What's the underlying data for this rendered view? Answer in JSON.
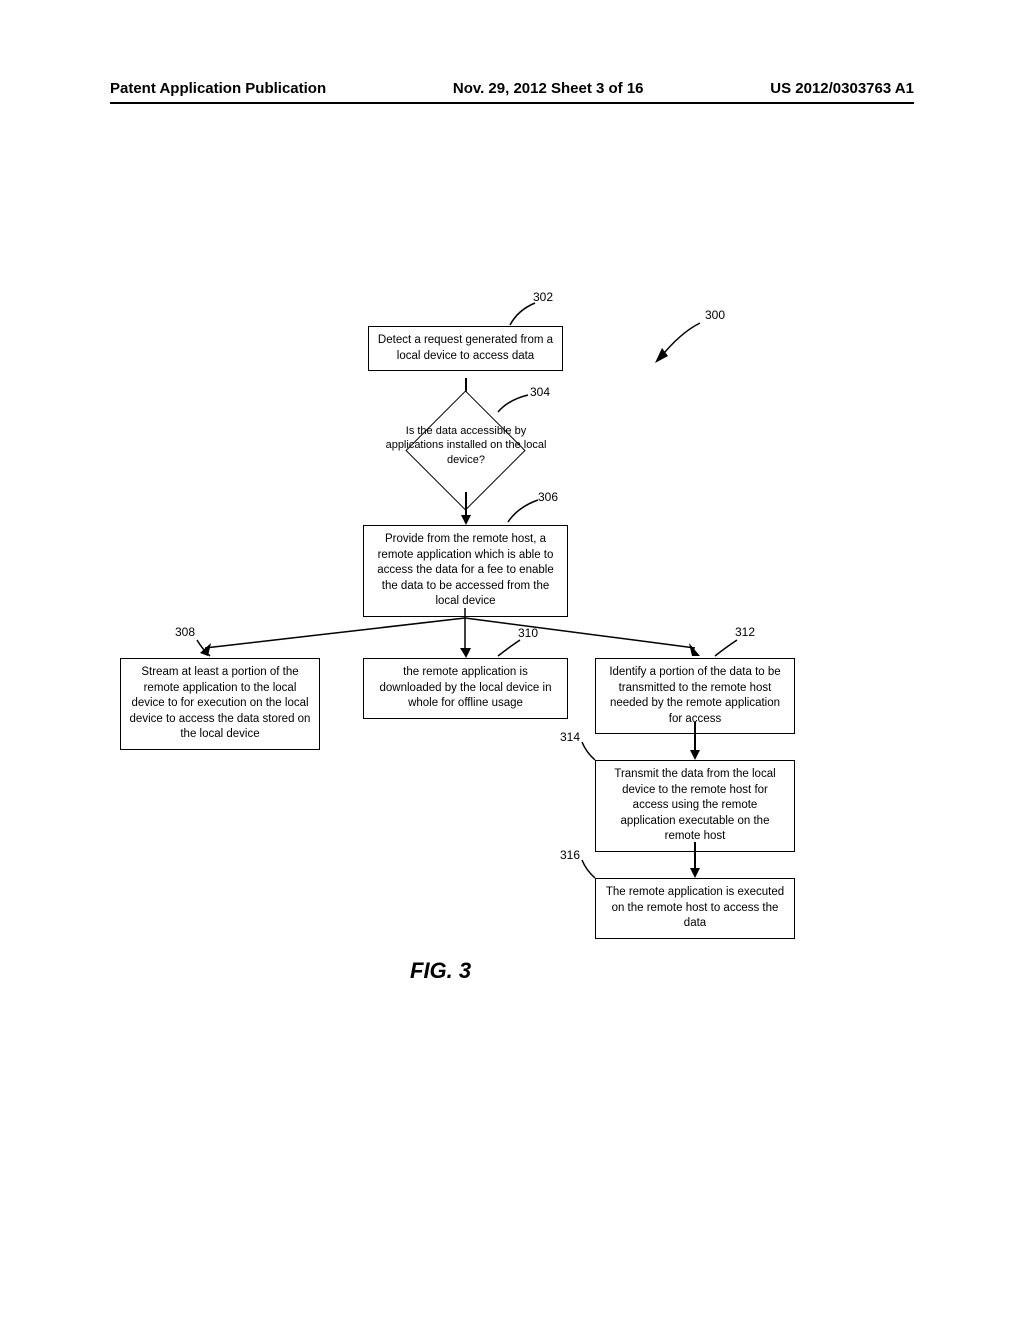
{
  "header": {
    "left": "Patent Application Publication",
    "center": "Nov. 29, 2012  Sheet 3 of 16",
    "right": "US 2012/0303763 A1"
  },
  "refs": {
    "r300": "300",
    "r302": "302",
    "r304": "304",
    "r306": "306",
    "r308": "308",
    "r310": "310",
    "r312": "312",
    "r314": "314",
    "r316": "316"
  },
  "boxes": {
    "b302": "Detect a request generated from a local device to access data",
    "b304": "Is the data accessible by applications installed on the local device?",
    "b306": "Provide from the remote host, a remote application which is able to access the data for a fee to enable the data to be accessed from the local device",
    "b308": "Stream at least a portion of the remote application to the local device to for execution on the local device to access the data stored on the local device",
    "b310": "the remote application is downloaded by the local device in whole for offline usage",
    "b312": "Identify a portion of the data to be transmitted to the remote host needed by the remote application for access",
    "b314": "Transmit the data from the local device to the remote host for access using the remote application executable on the remote host",
    "b316": "The remote application is executed on the remote host to access the data"
  },
  "figLabel": "FIG. 3"
}
